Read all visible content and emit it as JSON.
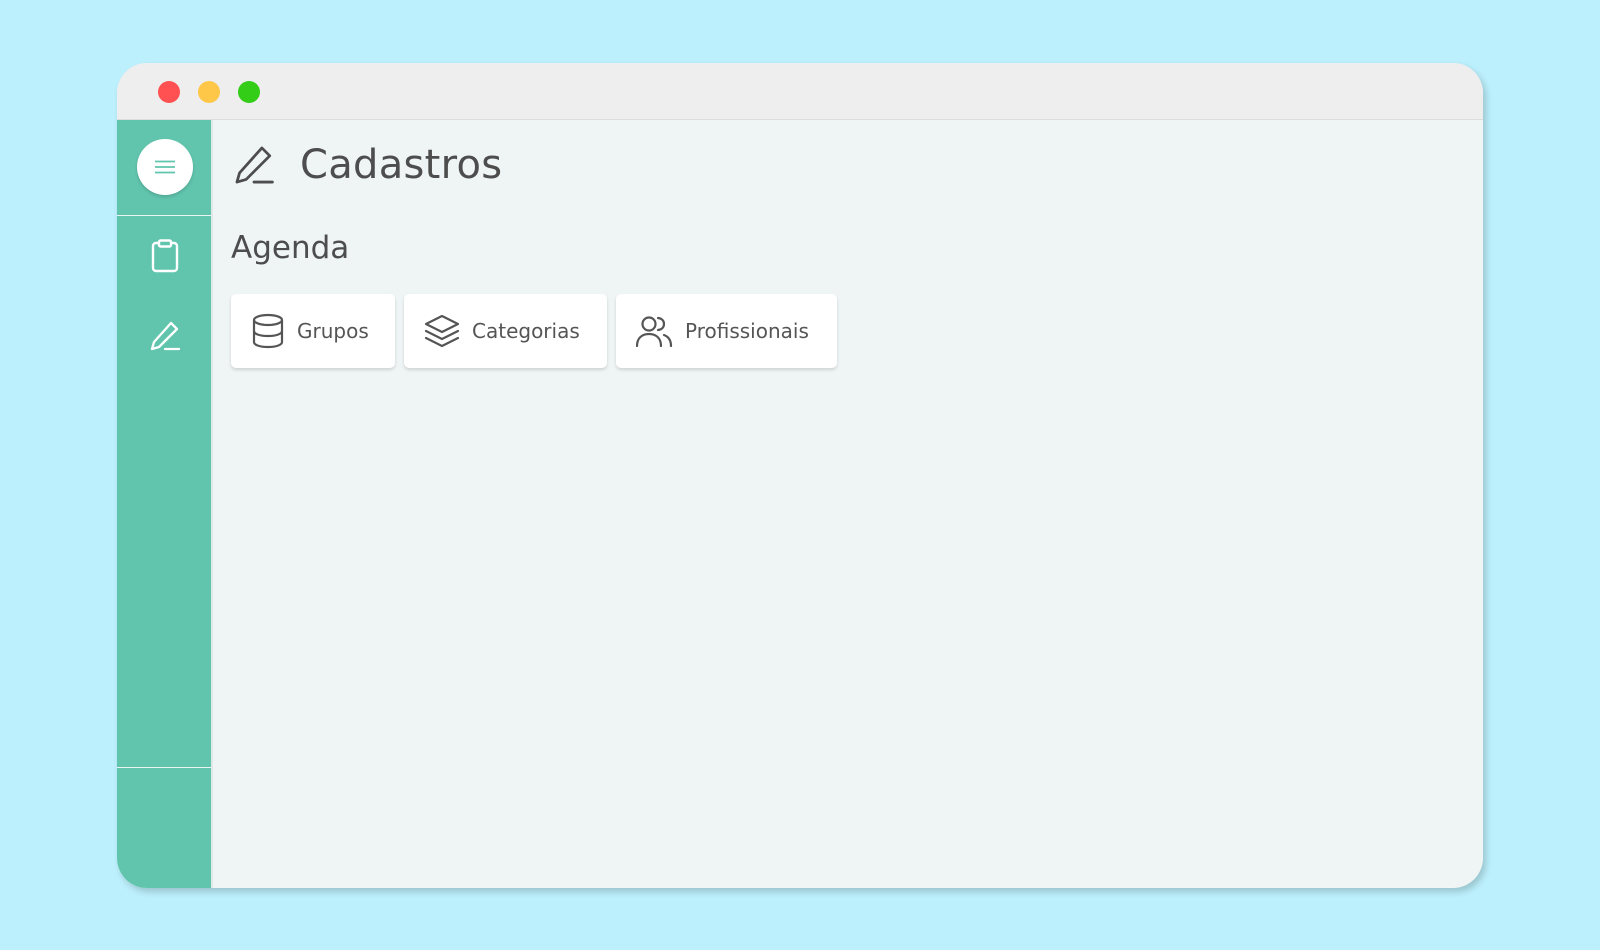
{
  "window": {
    "traffic_lights": [
      "close",
      "minimize",
      "maximize"
    ],
    "colors": {
      "close": "#ff5151",
      "minimize": "#ffc747",
      "maximize": "#33cc17",
      "sidebar": "#61c5ae",
      "background": "#bcf0fc"
    }
  },
  "sidebar": {
    "menu_icon": "hamburger-menu-icon",
    "items": [
      {
        "icon": "clipboard-icon"
      },
      {
        "icon": "pencil-icon"
      }
    ]
  },
  "header": {
    "icon": "pencil-icon",
    "title": "Cadastros"
  },
  "section": {
    "title": "Agenda",
    "cards": [
      {
        "icon": "database-icon",
        "label": "Grupos"
      },
      {
        "icon": "layers-icon",
        "label": "Categorias"
      },
      {
        "icon": "users-icon",
        "label": "Profissionais"
      }
    ]
  }
}
